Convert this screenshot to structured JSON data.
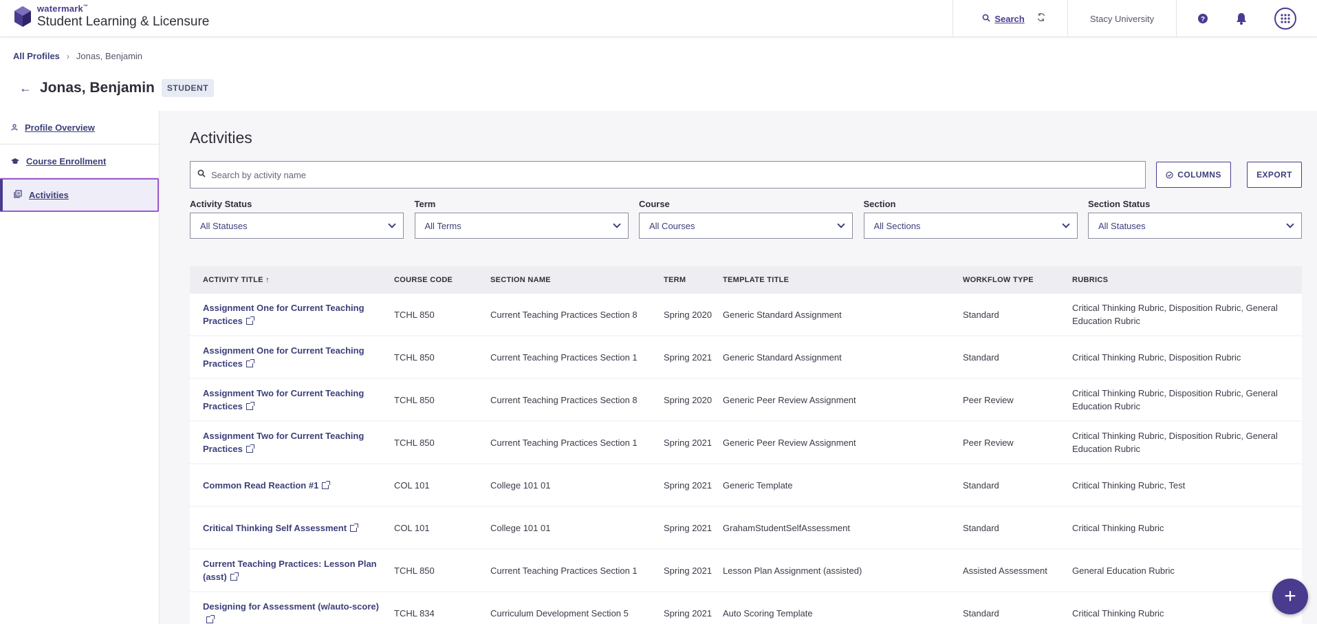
{
  "header": {
    "brand": "watermark",
    "brand_tm": "™",
    "app_title": "Student Learning & Licensure",
    "search_label": "Search",
    "university": "Stacy University",
    "icons": [
      "search-icon",
      "sync-icon",
      "help-icon",
      "bell-icon",
      "apps-grid-icon"
    ]
  },
  "breadcrumb": {
    "root": "All Profiles",
    "separator": "›",
    "current": "Jonas, Benjamin"
  },
  "profile": {
    "back": "←",
    "name": "Jonas, Benjamin",
    "role": "STUDENT"
  },
  "sidebar": {
    "items": [
      {
        "label": "Profile Overview",
        "icon": "user-icon"
      },
      {
        "label": "Course Enrollment",
        "icon": "graduation-cap-icon"
      },
      {
        "label": "Activities",
        "icon": "activities-icon",
        "active": true
      }
    ]
  },
  "main": {
    "title": "Activities",
    "search": {
      "placeholder": "Search by activity name",
      "value": ""
    },
    "columns_button": "COLUMNS",
    "export_button": "EXPORT",
    "filters": [
      {
        "label": "Activity Status",
        "value": "All Statuses"
      },
      {
        "label": "Term",
        "value": "All Terms"
      },
      {
        "label": "Course",
        "value": "All Courses"
      },
      {
        "label": "Section",
        "value": "All Sections"
      },
      {
        "label": "Section Status",
        "value": "All Statuses"
      }
    ],
    "table": {
      "sort_indicator": "↑",
      "headers": [
        "ACTIVITY TITLE",
        "COURSE CODE",
        "SECTION NAME",
        "TERM",
        "TEMPLATE TITLE",
        "WORKFLOW TYPE",
        "RUBRICS"
      ],
      "rows": [
        {
          "title": "Assignment One for Current Teaching Practices",
          "code": "TCHL 850",
          "section": "Current Teaching Practices Section 8",
          "term": "Spring 2020",
          "template": "Generic Standard Assignment",
          "workflow": "Standard",
          "rubrics": "Critical Thinking Rubric, Disposition Rubric, General Education Rubric"
        },
        {
          "title": "Assignment One for Current Teaching Practices",
          "code": "TCHL 850",
          "section": "Current Teaching Practices Section 1",
          "term": "Spring 2021",
          "template": "Generic Standard Assignment",
          "workflow": "Standard",
          "rubrics": "Critical Thinking Rubric, Disposition Rubric"
        },
        {
          "title": "Assignment Two for Current Teaching Practices",
          "code": "TCHL 850",
          "section": "Current Teaching Practices Section 8",
          "term": "Spring 2020",
          "template": "Generic Peer Review Assignment",
          "workflow": "Peer Review",
          "rubrics": "Critical Thinking Rubric, Disposition Rubric, General Education Rubric"
        },
        {
          "title": "Assignment Two for Current Teaching Practices",
          "code": "TCHL 850",
          "section": "Current Teaching Practices Section 1",
          "term": "Spring 2021",
          "template": "Generic Peer Review Assignment",
          "workflow": "Peer Review",
          "rubrics": "Critical Thinking Rubric, Disposition Rubric, General Education Rubric"
        },
        {
          "title": "Common Read Reaction #1",
          "code": "COL 101",
          "section": "College 101 01",
          "term": "Spring 2021",
          "template": "Generic Template",
          "workflow": "Standard",
          "rubrics": "Critical Thinking Rubric, Test"
        },
        {
          "title": "Critical Thinking Self Assessment",
          "code": "COL 101",
          "section": "College 101 01",
          "term": "Spring 2021",
          "template": "GrahamStudentSelfAssessment",
          "workflow": "Standard",
          "rubrics": "Critical Thinking Rubric"
        },
        {
          "title": "Current Teaching Practices: Lesson Plan (asst)",
          "code": "TCHL 850",
          "section": "Current Teaching Practices Section 1",
          "term": "Spring 2021",
          "template": "Lesson Plan Assignment (assisted)",
          "workflow": "Assisted Assessment",
          "rubrics": "General Education Rubric"
        },
        {
          "title": "Designing for Assessment (w/auto-score)",
          "code": "TCHL 834",
          "section": "Curriculum Development Section 5",
          "term": "Spring 2021",
          "template": "Auto Scoring Template",
          "workflow": "Standard",
          "rubrics": "Critical Thinking Rubric"
        }
      ]
    }
  },
  "fab_label": "+",
  "colors": {
    "accent": "#4a3b8f",
    "link": "#3b3f7a",
    "active_border": "#9b59d0",
    "main_bg": "#f6f6f8"
  }
}
